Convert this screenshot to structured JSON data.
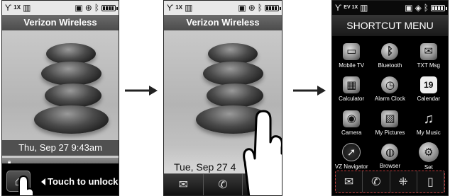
{
  "phone1": {
    "status_network": "1X",
    "carrier": "Verizon Wireless",
    "date_time": "Thu, Sep 27 9:43am",
    "unlock_label": "Touch to unlock"
  },
  "phone2": {
    "status_network": "1X",
    "carrier": "Verizon Wireless",
    "date_time_partial": "Tue, Sep 27 4"
  },
  "phone3": {
    "status_network": "EV 1X",
    "title": "SHORTCUT MENU",
    "items": [
      {
        "label": "Mobile TV",
        "icon": "tv-icon"
      },
      {
        "label": "Bluetooth",
        "icon": "bluetooth-icon"
      },
      {
        "label": "TXT Msg",
        "icon": "envelope-icon"
      },
      {
        "label": "Calculator",
        "icon": "calculator-icon"
      },
      {
        "label": "Alarm Clock",
        "icon": "alarm-clock-icon"
      },
      {
        "label": "Calendar",
        "icon": "calendar-icon",
        "badge": "19"
      },
      {
        "label": "Camera",
        "icon": "camera-icon"
      },
      {
        "label": "My Pictures",
        "icon": "pictures-icon"
      },
      {
        "label": "My Music",
        "icon": "music-icon"
      },
      {
        "label": "VZ Navigator",
        "icon": "compass-icon"
      },
      {
        "label": "Browser",
        "icon": "globe-icon"
      },
      {
        "label": "Set",
        "icon": "gear-icon"
      }
    ]
  },
  "colors": {
    "status_bar_light": "#e8e8e8",
    "status_bar_dark": "#0a0a0a",
    "carrier_bar": "#5a5a5a",
    "dock_highlight": "#c04040"
  }
}
